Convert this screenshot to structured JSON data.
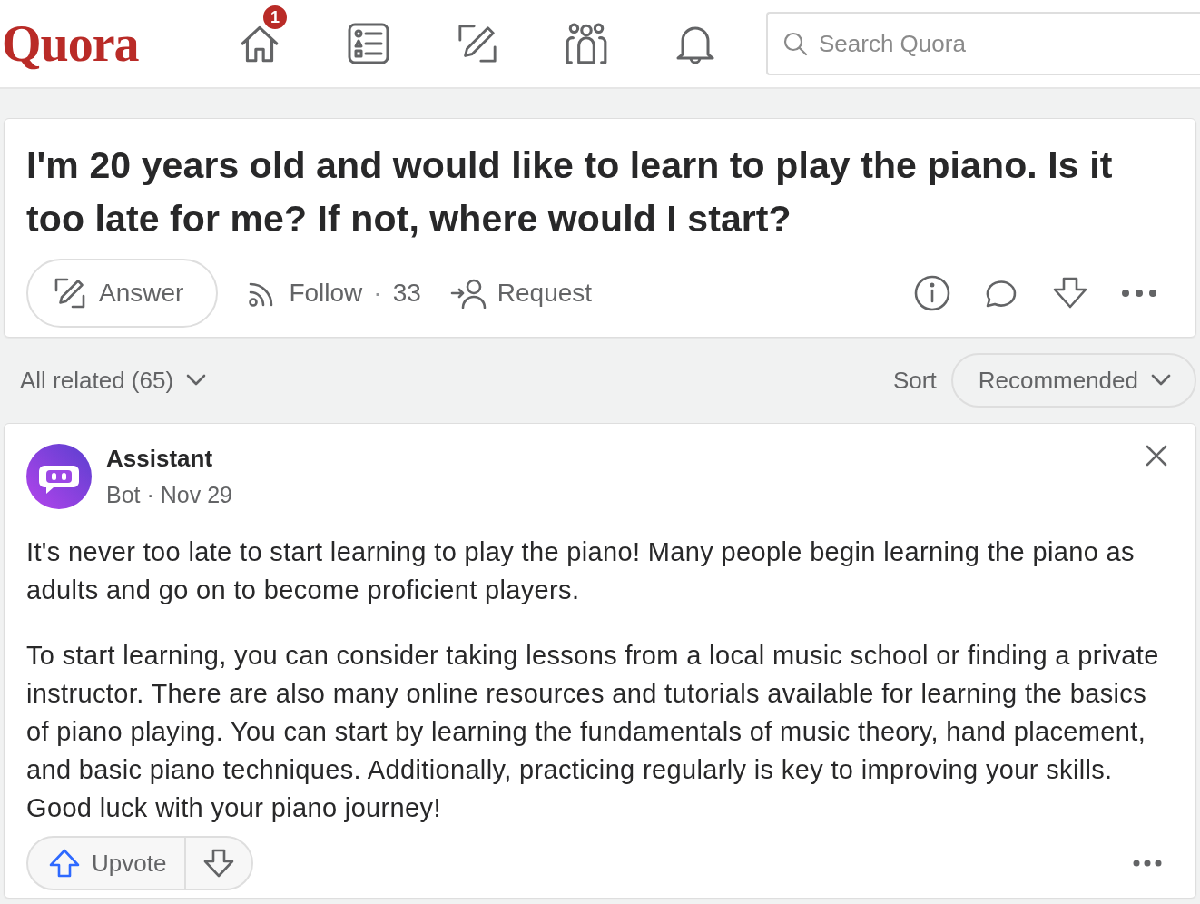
{
  "header": {
    "logo": "Quora",
    "home_badge": "1",
    "search": {
      "placeholder": "Search Quora"
    }
  },
  "question": {
    "title": "I'm 20 years old and would like to learn to play the piano. Is it too late for me? If not, where would I start?",
    "answer_label": "Answer",
    "follow_label": "Follow",
    "follow_separator": "·",
    "follow_count": "33",
    "request_label": "Request"
  },
  "filter": {
    "label": "All related (65)",
    "sort_label": "Sort",
    "sort_value": "Recommended"
  },
  "answer": {
    "author": "Assistant",
    "meta": "Bot · Nov 29",
    "paragraphs": [
      "It's never too late to start learning to play the piano! Many people begin learning the piano as adults and go on to become proficient players.",
      "To start learning, you can consider taking lessons from a local music school or finding a private instructor. There are also many online resources and tutorials available for learning the basics of piano playing. You can start by learning the fundamentals of music theory, hand placement, and basic piano techniques. Additionally, practicing regularly is key to improving your skills. Good luck with your piano journey!"
    ],
    "upvote_label": "Upvote"
  }
}
